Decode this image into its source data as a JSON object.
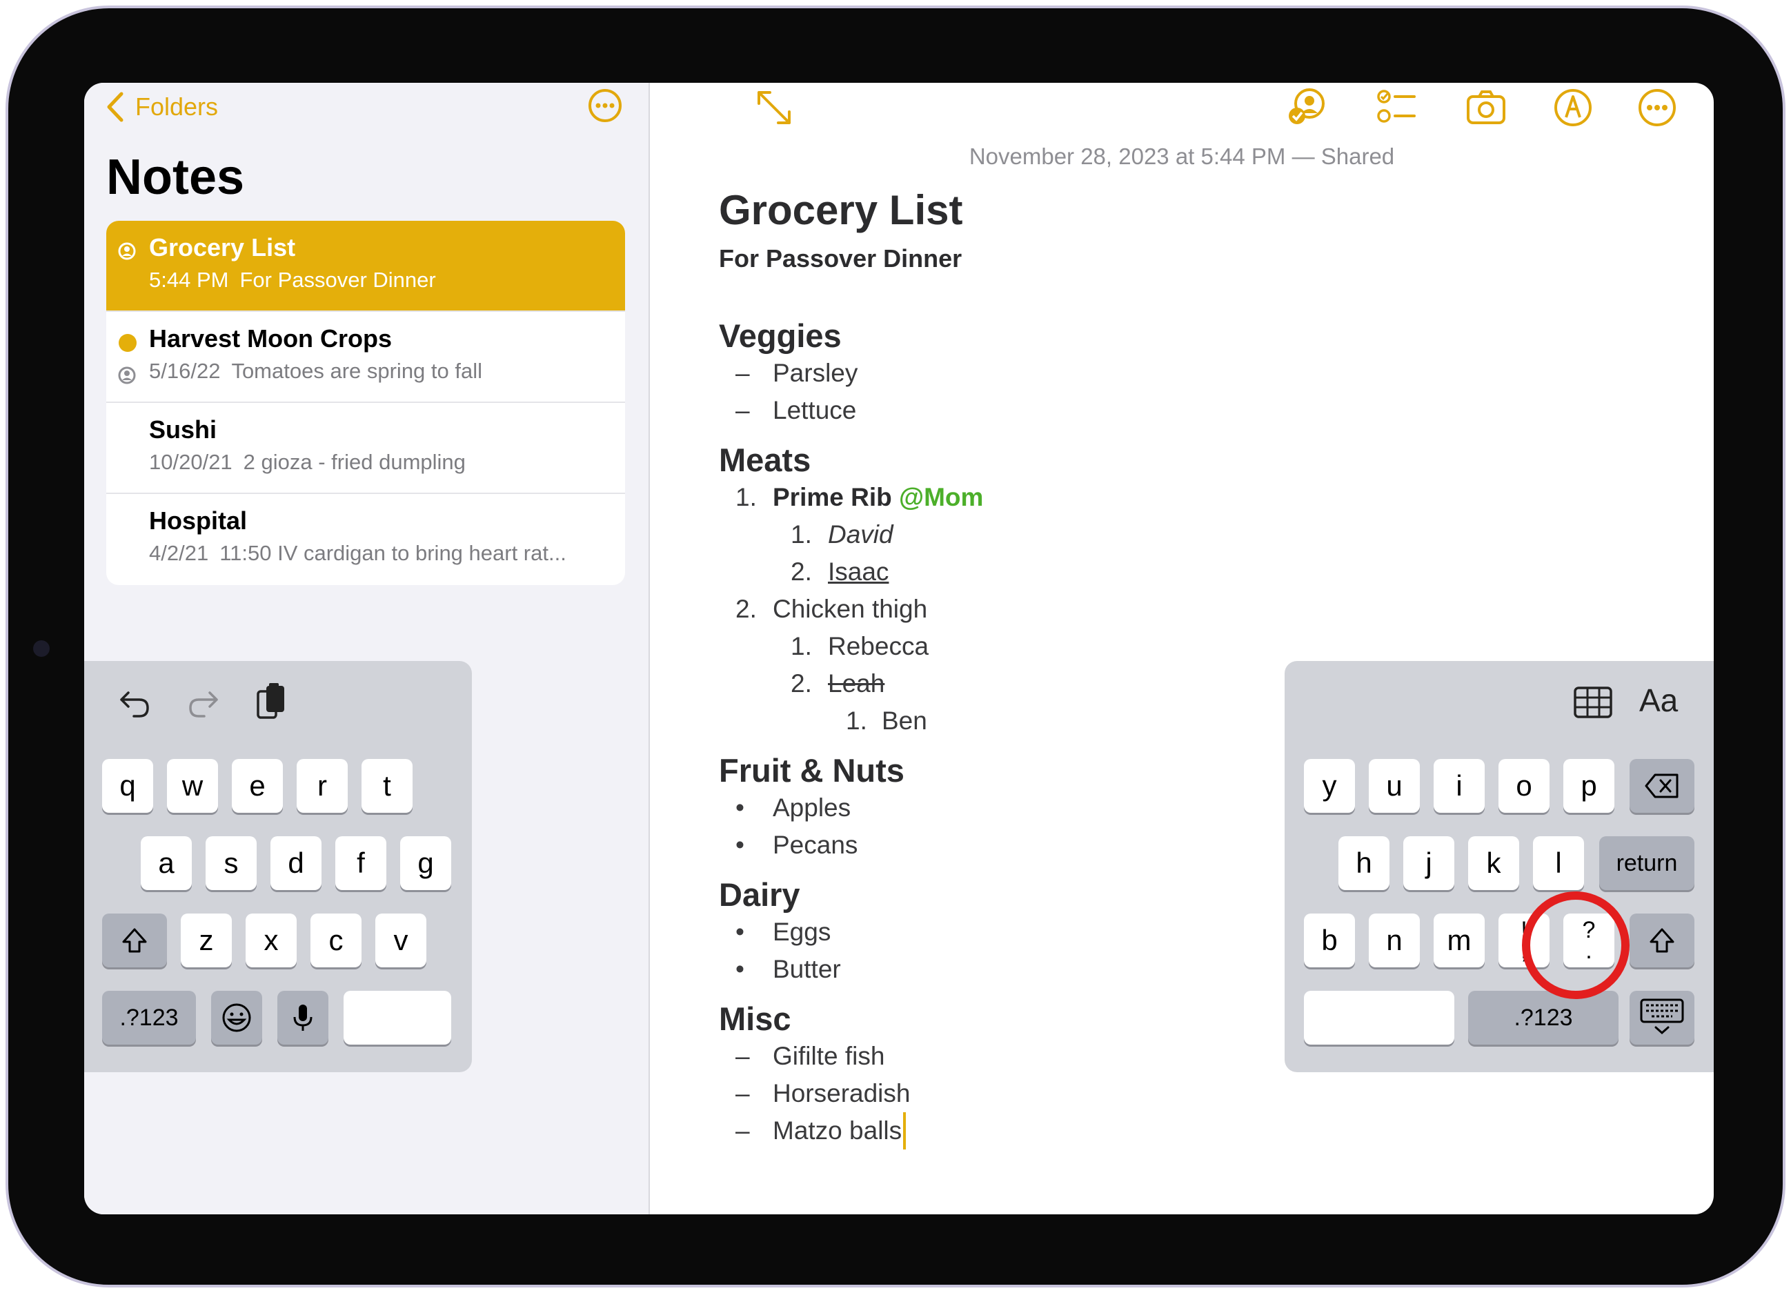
{
  "sidebar": {
    "back_label": "Folders",
    "heading": "Notes",
    "notes": [
      {
        "title": "Grocery List",
        "time": "5:44 PM",
        "preview": "For Passover Dinner"
      },
      {
        "title": "Harvest Moon Crops",
        "time": "5/16/22",
        "preview": "Tomatoes are spring to fall"
      },
      {
        "title": "Sushi",
        "time": "10/20/21",
        "preview": "2 gioza - fried dumpling"
      },
      {
        "title": "Hospital",
        "time": "4/2/21",
        "preview": "11:50 IV cardigan to bring heart rat..."
      }
    ]
  },
  "note": {
    "date": "November 28, 2023 at 5:44 PM — Shared",
    "title": "Grocery List",
    "subtitle": "For Passover Dinner",
    "veggies": {
      "heading": "Veggies",
      "items": [
        "Parsley",
        "Lettuce"
      ]
    },
    "meats": {
      "heading": "Meats",
      "item1": "Prime Rib",
      "mention": "@Mom",
      "item1_sub": [
        "David",
        "Isaac"
      ],
      "item2": "Chicken thigh",
      "item2_sub": [
        "Rebecca",
        "Leah"
      ],
      "item2_subsub": [
        "Ben"
      ]
    },
    "fruit": {
      "heading": "Fruit & Nuts",
      "items": [
        "Apples",
        "Pecans"
      ]
    },
    "dairy": {
      "heading": "Dairy",
      "items": [
        "Eggs",
        "Butter"
      ]
    },
    "misc": {
      "heading": "Misc",
      "items": [
        "Gifilte fish",
        "Horseradish",
        "Matzo balls"
      ]
    },
    "markers": {
      "dash": "–",
      "bullet": "•",
      "n1": "1.",
      "n2": "2."
    }
  },
  "keyboard": {
    "left_rows": [
      [
        "q",
        "w",
        "e",
        "r",
        "t"
      ],
      [
        "a",
        "s",
        "d",
        "f",
        "g"
      ],
      [
        "z",
        "x",
        "c",
        "v"
      ]
    ],
    "right_rows": [
      [
        "y",
        "u",
        "i",
        "o",
        "p"
      ],
      [
        "h",
        "j",
        "k",
        "l"
      ],
      [
        "b",
        "n",
        "m"
      ]
    ],
    "punct1_top": "!",
    "punct1_bottom": ",",
    "punct2_top": "?",
    "punct2_bottom": ".",
    "return_label": "return",
    "numbers_label": ".?123",
    "format_label": "Aa"
  },
  "colors": {
    "accent": "#e4af0b",
    "mention": "#4caf2a",
    "highlight_ring": "#e31e1e"
  }
}
